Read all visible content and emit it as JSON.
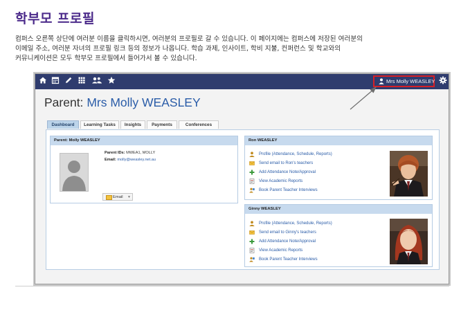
{
  "doc": {
    "title": "학부모 프로필",
    "desc_lines": [
      "컴퍼스 오른쪽 상단에 여러분 이름을 클릭하시면, 여러분의 프로필로 갈 수 있습니다. 이 페이지에는 컴퍼스에 저장된 여러분의",
      "이메일 주소, 여러분 자녀의 프로필 링크 등의 정보가 나옵니다. 학습 과제, 인사이트, 학비 지불, 컨퍼런스 및 학교와의",
      "커뮤니케이션은 모두 학부모 프로필에서 들어가서 볼 수 있습니다."
    ]
  },
  "topbar": {
    "nav_icons": [
      "home-icon",
      "calendar-icon",
      "pencil-icon",
      "grid-icon",
      "people-icon",
      "star-icon"
    ],
    "user_label": "Mrs Molly WEASLEY",
    "settings_icon": "gear-icon",
    "bar_color": "#2f3c6e",
    "highlight_color": "#d61f26"
  },
  "page": {
    "title_prefix": "Parent:",
    "title_name": "Mrs Molly WEASLEY",
    "tabs": [
      "Dashboard",
      "Learning Tasks",
      "Insights",
      "Payments",
      "Conferences"
    ],
    "active_tab": "Dashboard"
  },
  "parent_box": {
    "header": "Parent: Molly WEASLEY",
    "ids_label": "Parent IDs:",
    "ids_value": "MWEA1, MOLLY",
    "email_label": "Email:",
    "email_value": "molly@weasley.net.au",
    "email_button": "Email"
  },
  "children": [
    {
      "header": "Ron WEASLEY",
      "links": [
        "Profile (Attendance, Schedule, Reports)",
        "Send email to Ron's teachers",
        "Add Attendance Note/Approval",
        "View Academic Reports",
        "Book Parent Teacher Interviews"
      ]
    },
    {
      "header": "Ginny WEASLEY",
      "links": [
        "Profile (Attendance, Schedule, Reports)",
        "Send email to Ginny's teachers",
        "Add Attendance Note/Approval",
        "View Academic Reports",
        "Book Parent Teacher Interviews"
      ]
    }
  ],
  "link_icons": [
    "user-profile-icon",
    "envelope-icon",
    "plus-icon",
    "report-icon",
    "interview-icon"
  ]
}
